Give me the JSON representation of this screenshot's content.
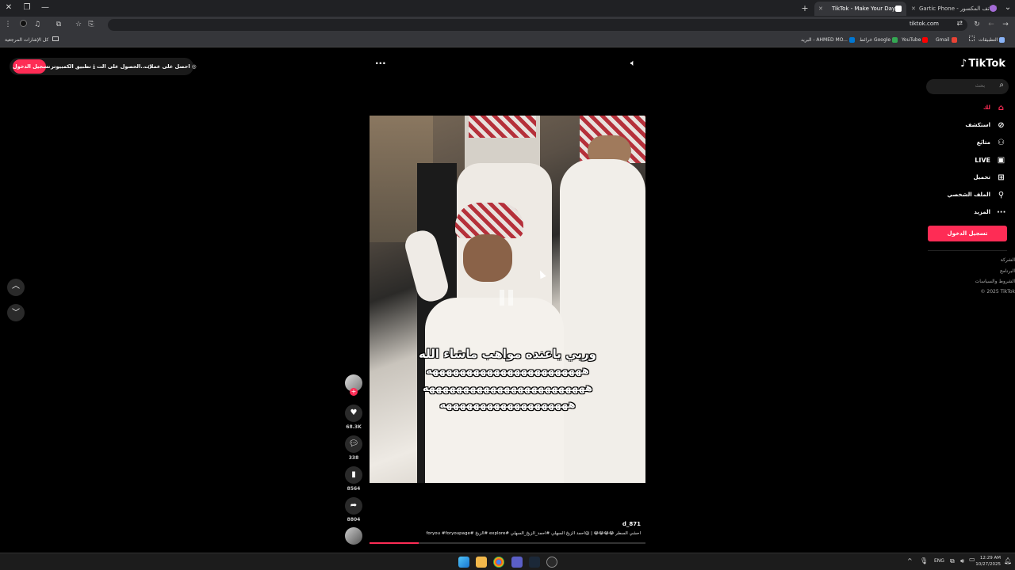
{
  "browser": {
    "tabs": [
      {
        "label": "Gartic Phone - الهاتف المكسور",
        "active": false
      },
      {
        "label": "TikTok - Make Your Day",
        "active": true
      }
    ],
    "new_tab_symbol": "+",
    "url": "tiktok.com",
    "bookmarks": [
      {
        "label": "التطبيقات",
        "color": "#8ab4f8"
      },
      {
        "label": "Gmail",
        "color": "#ea4335"
      },
      {
        "label": "YouTube",
        "color": "#ff0000"
      },
      {
        "label": "خرائط Google",
        "color": "#34a853"
      },
      {
        "label": "البريد - AHMED MO...",
        "color": "#0078d4"
      }
    ],
    "all_bookmarks": "كل الإشارات المرجعية"
  },
  "tiktok": {
    "logo": "TikTok",
    "search_placeholder": "بحث",
    "nav": [
      {
        "label": "لك",
        "icon": "home-icon",
        "active": true
      },
      {
        "label": "استكشف",
        "icon": "compass-icon",
        "active": false
      },
      {
        "label": "متابَع",
        "icon": "following-icon",
        "active": false
      },
      {
        "label": "LIVE",
        "icon": "live-icon",
        "active": false
      },
      {
        "label": "تحميل",
        "icon": "upload-icon",
        "active": false
      },
      {
        "label": "الملف الشخصي",
        "icon": "profile-icon",
        "active": false
      },
      {
        "label": "المزيد",
        "icon": "more-icon",
        "active": false
      }
    ],
    "login_label": "تسجيل الدخول",
    "footer": [
      "الشركة",
      "البرنامج",
      "الشروط والسياسات",
      "© 2025 TikTok"
    ],
    "top_bar": {
      "login": "تسجيل الدخول",
      "desktop_app": "تطبيق الكمبيوتر",
      "get_app": "الحصول على الت...",
      "get_coins": "احصل على عملات"
    },
    "video": {
      "caption_lines": [
        "وربي ياعنده مواهب ماشاء الله",
        "هههههههههههههههههههههههه",
        "ههههههههههههههههههههههههه",
        "هههههههههههههههههههه"
      ],
      "author": "d_871",
      "description": "احشي السطر 😂😂😂😂 | @احمد الزيخ السهلي #احمد_الزيخ_السهلي #explore #الزيخ #foryou #foryoupage"
    },
    "actions": {
      "likes": "68.3K",
      "comments": "338",
      "saves": "8564",
      "shares": "8804"
    },
    "accent": "#fe2c55"
  },
  "taskbar": {
    "lang": "ENG",
    "time": "12:29 AM",
    "date": "10/27/2025"
  }
}
